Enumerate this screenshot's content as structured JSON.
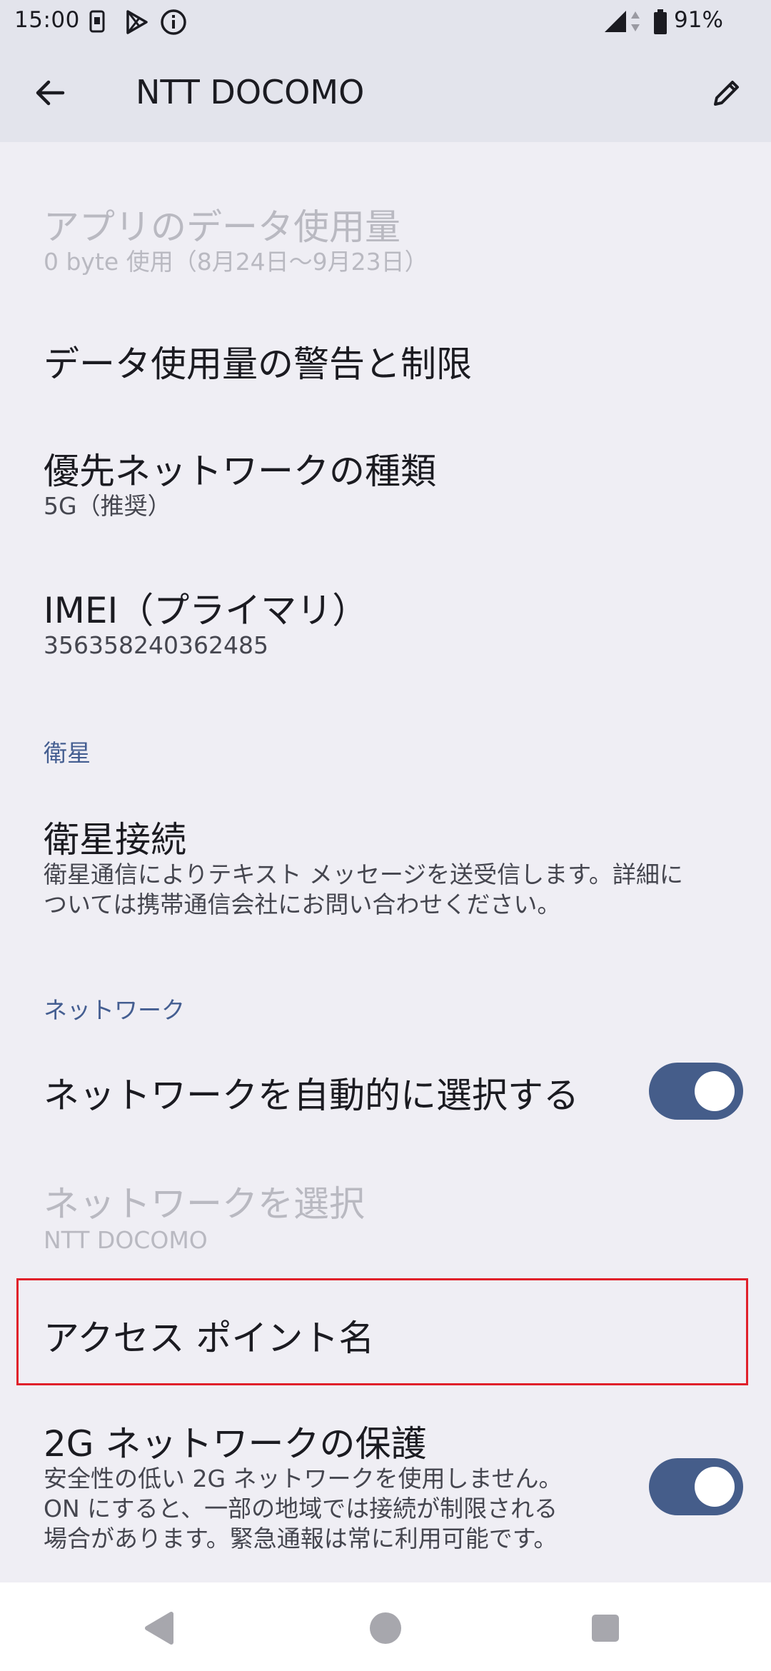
{
  "status_bar": {
    "time": "15:00",
    "battery": "91%",
    "icons": [
      "sim-icon",
      "play-store-icon",
      "info-icon",
      "signal-icon",
      "data-arrows-icon",
      "battery-icon"
    ]
  },
  "toolbar": {
    "title": "NTT DOCOMO",
    "back_icon": "arrow-back-icon",
    "edit_icon": "pencil-icon"
  },
  "settings": {
    "app_data_usage": {
      "title": "アプリのデータ使用量",
      "summary": "0 byte 使用（8月24日〜9月23日）",
      "enabled": false
    },
    "data_warning": {
      "title": "データ使用量の警告と制限"
    },
    "preferred_network": {
      "title": "優先ネットワークの種類",
      "summary": "5G（推奨）"
    },
    "imei": {
      "title": "IMEI（プライマリ）",
      "summary": "356358240362485"
    },
    "satellite_category": "衛星",
    "satellite_connection": {
      "title": "衛星接続",
      "summary_line1": "衛星通信によりテキスト メッセージを送受信します。詳細に",
      "summary_line2": "ついては携帯通信会社にお問い合わせください。"
    },
    "network_category": "ネットワーク",
    "auto_select_network": {
      "title": "ネットワークを自動的に選択する",
      "checked": true
    },
    "select_network": {
      "title": "ネットワークを選択",
      "summary": "NTT DOCOMO",
      "enabled": false
    },
    "access_point_names": {
      "title": "アクセス ポイント名"
    },
    "protect_2g": {
      "title": "2G ネットワークの保護",
      "summary_line1": "安全性の低い 2G ネットワークを使用しません。",
      "summary_line2": "ON にすると、一部の地域では接続が制限される",
      "summary_line3": "場合があります。緊急通報は常に利用可能です。",
      "checked": true
    }
  },
  "navigation_bar": {
    "buttons": [
      "back-triangle-icon",
      "home-circle-icon",
      "recents-square-icon"
    ]
  },
  "colors": {
    "background": "#efeef4",
    "top_band": "#e3e4ec",
    "accent": "#445e91",
    "switch_track": "#455d8a",
    "highlight_border": "#e0202a",
    "disabled_text": "#b9b9c1"
  }
}
